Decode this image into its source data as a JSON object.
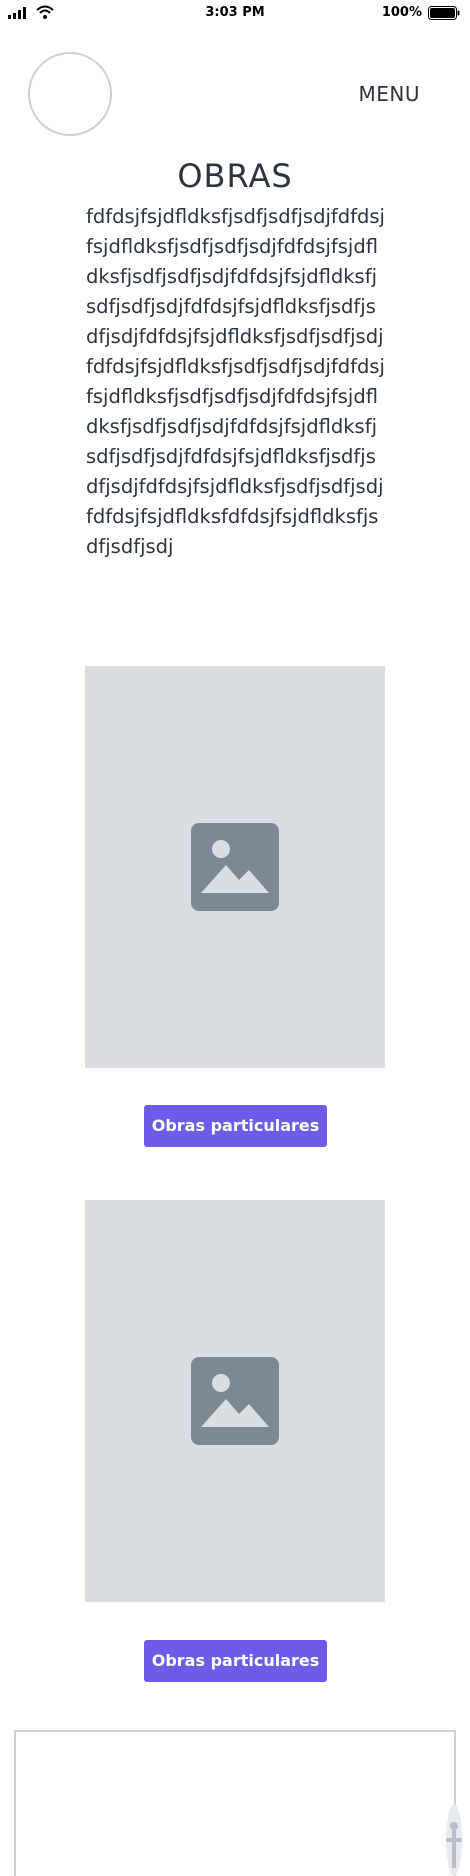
{
  "status_bar": {
    "time": "3:03 PM",
    "battery_percent": "100%",
    "icons": [
      "signal-icon",
      "wifi-icon",
      "battery-icon"
    ]
  },
  "header": {
    "menu_label": "MENU"
  },
  "main": {
    "title": "OBRAS",
    "body_text": "fdfdsjfsjdfldksfjsdfjsdfjsdjfdfdsjfsjdfldksfjsdfjsdfjsdjfdfdsjfsjdfldksfjsdfjsdfjsdjfdfdsjfsjdfldksfjsdfjsdfjsdjfdfdsjfsjdfldksfjsdfjsdfjsdjfdfdsjfsjdfldksfjsdfjsdfjsdjfdfdsjfsjdfldksfjsdfjsdfjsdjfdfdsjfsjdfldksfjsdfjsdfjsdjfdfdsjfsjdfldksfjsdfjsdfjsdjfdfdsjfsjdfldksfjsdfjsdfjsdjfdfdsjfsjdfldksfjsdfjsdfjsdjfdfdsjfsjdfldksfjsdfjsdfjsdjfdfdsjfsjdfldksfdfdsjfsjdfldksfjsdfjsdfjsdj",
    "items": [
      {
        "image_icon": "image-placeholder-icon",
        "button_label": "Obras particulares"
      },
      {
        "image_icon": "image-placeholder-icon",
        "button_label": "Obras particulares"
      }
    ]
  },
  "colors": {
    "accent": "#6c5ce7",
    "placeholder_bg": "#dadde1",
    "placeholder_icon": "#7d8895",
    "outline": "#c9d1db",
    "text": "#2b3441"
  }
}
